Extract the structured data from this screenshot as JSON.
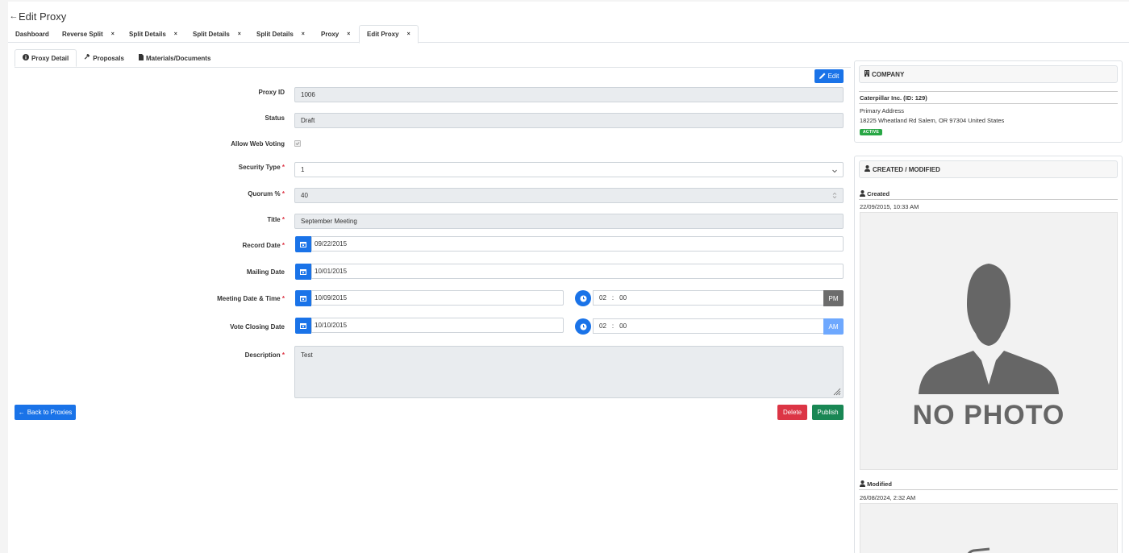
{
  "header": {
    "back_icon": "arrow-left-icon",
    "title": "Edit Proxy"
  },
  "tabs": [
    {
      "label": "Dashboard",
      "closable": false
    },
    {
      "label": "Reverse Split",
      "closable": true
    },
    {
      "label": "Split Details",
      "closable": true
    },
    {
      "label": "Split Details",
      "closable": true
    },
    {
      "label": "Split Details",
      "closable": true
    },
    {
      "label": "Proxy",
      "closable": true
    },
    {
      "label": "Edit Proxy",
      "closable": true,
      "active": true
    }
  ],
  "tab_close_glyph": "×",
  "subtabs": [
    {
      "label": "Proxy Detail",
      "icon": "info-circle-icon",
      "active": true
    },
    {
      "label": "Proposals",
      "icon": "gavel-icon"
    },
    {
      "label": "Materials/Documents",
      "icon": "file-icon"
    }
  ],
  "buttons": {
    "edit": "Edit",
    "back": "Back to Proxies",
    "delete": "Delete",
    "publish": "Publish"
  },
  "form": {
    "proxy_id": {
      "label": "Proxy ID",
      "value": "1006"
    },
    "status": {
      "label": "Status",
      "value": "Draft"
    },
    "allow_web_voting": {
      "label": "Allow Web Voting",
      "checked": true
    },
    "security_type": {
      "label": "Security Type",
      "value": "1"
    },
    "quorum": {
      "label": "Quorum %",
      "value": "40"
    },
    "title": {
      "label": "Title",
      "value": "September Meeting"
    },
    "record_date": {
      "label": "Record Date",
      "value": "09/22/2015"
    },
    "mailing_date": {
      "label": "Mailing Date",
      "value": "10/01/2015"
    },
    "meeting_date": {
      "label": "Meeting Date & Time",
      "value": "10/09/2015",
      "hour": "02",
      "minute": "00",
      "ampm": "PM"
    },
    "vote_closing_date": {
      "label": "Vote Closing Date",
      "value": "10/10/2015",
      "hour": "02",
      "minute": "00",
      "ampm": "AM"
    },
    "description": {
      "label": "Description",
      "value": "Test"
    },
    "required_mark": "*",
    "time_sep": ":"
  },
  "company": {
    "header": "COMPANY",
    "name": "Caterpillar Inc. (ID: 129)",
    "address_label": "Primary Address",
    "address": "18225 Wheatland Rd Salem, OR 97304 United States",
    "status_badge": "ACTIVE"
  },
  "audit": {
    "header": "CREATED / MODIFIED",
    "created_label": "Created",
    "created_at": "22/09/2015, 10:33 AM",
    "modified_label": "Modified",
    "modified_at": "26/08/2024, 2:32 AM",
    "no_photo_text": "NO PHOTO"
  },
  "colors": {
    "primary": "#1a73e8",
    "danger": "#dc3545",
    "success": "#198754",
    "pm_active": "#6c6c6c",
    "am_inactive": "#6ea8fe"
  }
}
